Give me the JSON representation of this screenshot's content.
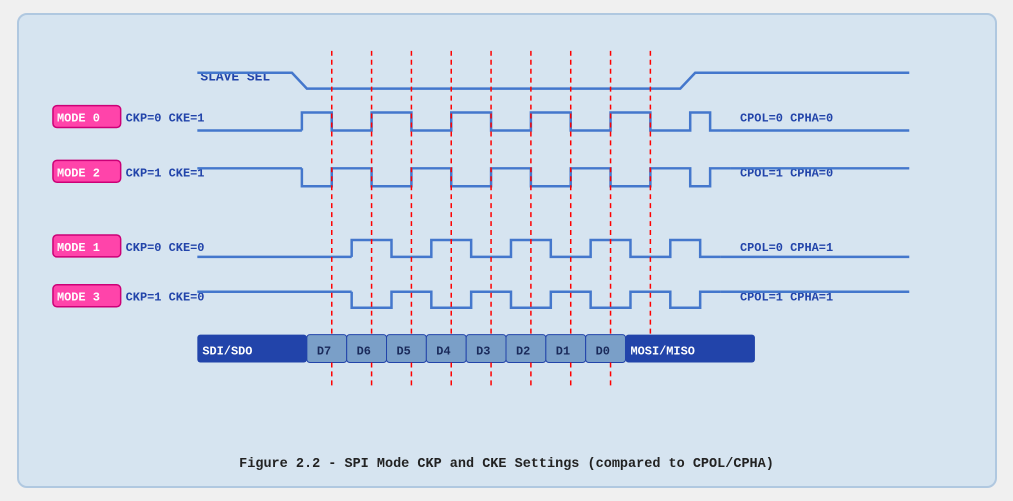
{
  "caption": "Figure 2.2 - SPI Mode CKP and CKE Settings (compared to CPOL/CPHA)",
  "diagram": {
    "slave_sel": "SLAVE SEL",
    "modes": [
      {
        "id": "MODE 0",
        "params": "CKP=0  CKE=1",
        "cpol_cpha": "CPOL=0  CPHA=0"
      },
      {
        "id": "MODE 2",
        "params": "CKP=1  CKE=1",
        "cpol_cpha": "CPOL=1  CPHA=0"
      },
      {
        "id": "MODE 1",
        "params": "CKP=0  CKE=0",
        "cpol_cpha": "CPOL=0  CPHA=1"
      },
      {
        "id": "MODE 3",
        "params": "CKP=1  CKE=0",
        "cpol_cpha": "CPOL=1  CPHA=1"
      }
    ],
    "data_bits": [
      "SDI/SDO",
      "D7",
      "D6",
      "D5",
      "D4",
      "D3",
      "D2",
      "D1",
      "D0",
      "MOSI/MISO"
    ]
  }
}
